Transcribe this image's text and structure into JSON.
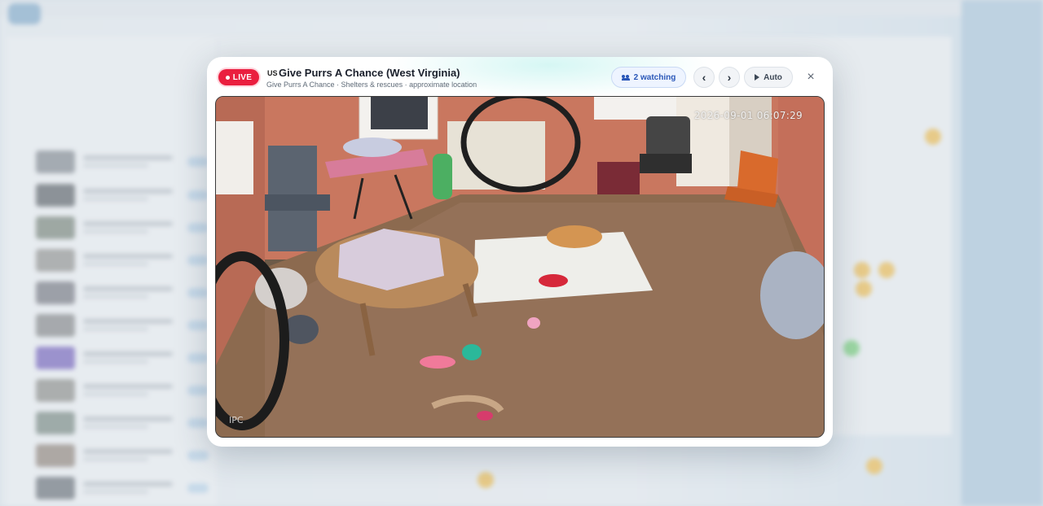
{
  "stream": {
    "live_label": "LIVE",
    "country_code": "US",
    "title": "Give Purrs A Chance (West Virginia)",
    "subtitle": "Give Purrs A Chance · Shelters & rescues · approximate location",
    "watching_label": "2 watching",
    "prev_label": "‹",
    "next_label": "›",
    "auto_label": "Auto",
    "close_label": "×"
  },
  "video": {
    "timestamp": "2026-09-01 06:07:29",
    "watermark": "IPC"
  },
  "icons": {
    "watching": "people-icon",
    "auto": "play-icon",
    "close": "close-icon",
    "prev": "chevron-left-icon",
    "next": "chevron-right-icon"
  },
  "colors": {
    "live": "#ea1f3f",
    "watching_text": "#2a57b8",
    "modal_bg": "#ffffff"
  }
}
